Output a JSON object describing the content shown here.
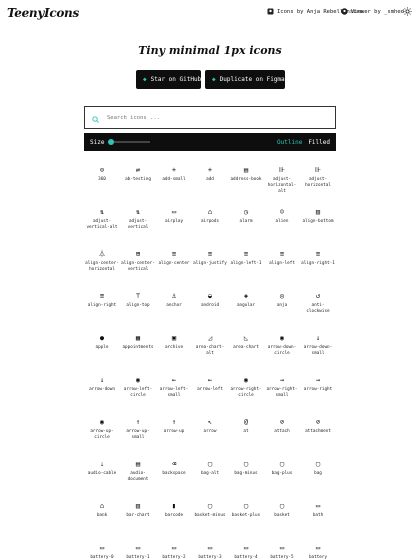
{
  "header": {
    "logo": "TeenyIcons",
    "credit_icons": "Icons by Anja Rebellensire",
    "credit_viewer": "Viewer by _smhed"
  },
  "hero": {
    "title": "Tiny minimal 1px icons",
    "github_label": "Star on GitHub",
    "figma_label": "Duplicate on Figma"
  },
  "search": {
    "placeholder": "Search icons ..."
  },
  "controls": {
    "size_label": "Size",
    "size_value": 0.0,
    "outline_label": "Outline",
    "filled_label": "Filled"
  },
  "colors": {
    "accent": "#2ec4b6",
    "dark": "#0e0e0e"
  },
  "icons": [
    "360",
    "ab-testing",
    "add-small",
    "add",
    "address-book",
    "adjust-horizontal-alt",
    "adjust-horizontal",
    "adjust-vertical-alt",
    "adjust-vertical",
    "airplay",
    "airpods",
    "alarm",
    "alien",
    "align-bottom",
    "align-center-horizontal",
    "align-center-vertical",
    "align-center",
    "align-justify",
    "align-left-1",
    "align-left",
    "align-right-1",
    "align-right",
    "align-top",
    "anchor",
    "android",
    "angular",
    "anja",
    "anti-clockwise",
    "apple",
    "appointments",
    "archive",
    "area-chart-alt",
    "area-chart",
    "arrow-down-circle",
    "arrow-down-small",
    "arrow-down",
    "arrow-left-circle",
    "arrow-left-small",
    "arrow-left",
    "arrow-right-circle",
    "arrow-right-small",
    "arrow-right",
    "arrow-up-circle",
    "arrow-up-small",
    "arrow-up",
    "arrow",
    "at",
    "attach",
    "attachment",
    "audio-cable",
    "audio-document",
    "backspace",
    "bag-alt",
    "bag-minus",
    "bag-plus",
    "bag",
    "bank",
    "bar-chart",
    "barcode",
    "basket-minus",
    "basket-plus",
    "basket",
    "bath",
    "battery-0",
    "battery-1",
    "battery-2",
    "battery-3",
    "battery-4",
    "battery-5",
    "battery"
  ],
  "icon_glyphs": [
    "⊙",
    "⇄",
    "+",
    "+",
    "▤",
    "⊪",
    "⊪",
    "⇅",
    "⇅",
    "▭",
    "⌂",
    "◷",
    "☺",
    "▥",
    "⏃",
    "⊞",
    "≡",
    "≡",
    "≡",
    "≡",
    "≡",
    "≡",
    "⊤",
    "⚓",
    "◒",
    "◈",
    "◎",
    "↺",
    "●",
    "▦",
    "▣",
    "◿",
    "◺",
    "◉",
    "↓",
    "↓",
    "◉",
    "←",
    "←",
    "◉",
    "→",
    "→",
    "◉",
    "↑",
    "↑",
    "↖",
    "@",
    "⊘",
    "⊘",
    "⇣",
    "▤",
    "⌫",
    "▢",
    "▢",
    "▢",
    "▢",
    "⌂",
    "▥",
    "▮",
    "▢",
    "▢",
    "▢",
    "▭",
    "▭",
    "▭",
    "▭",
    "▭",
    "▭",
    "▭",
    "▭"
  ]
}
